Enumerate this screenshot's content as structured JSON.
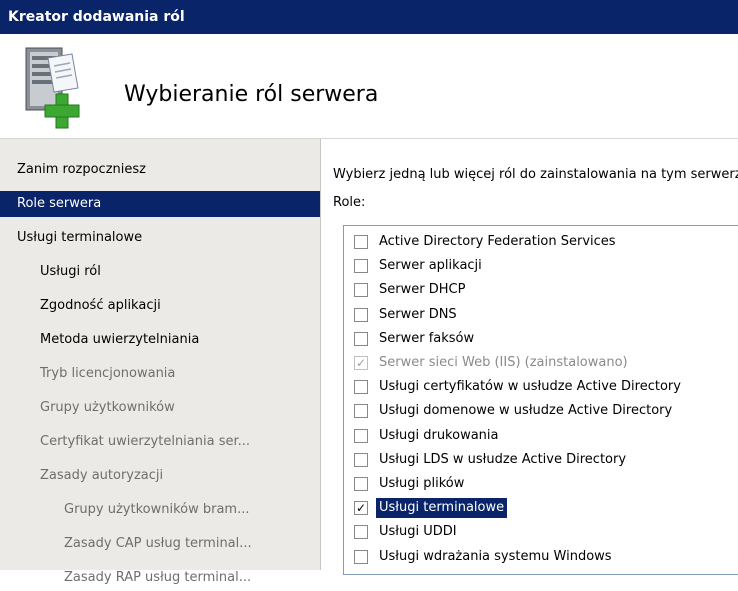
{
  "window": {
    "title": "Kreator dodawania ról"
  },
  "header": {
    "title": "Wybieranie ról serwera",
    "icon": "server-add-icon"
  },
  "nav": {
    "items": [
      {
        "label": "Zanim rozpoczniesz",
        "state": "normal",
        "indent": 0
      },
      {
        "label": "Role serwera",
        "state": "selected",
        "indent": 0
      },
      {
        "label": "Usługi terminalowe",
        "state": "normal",
        "indent": 0
      },
      {
        "label": "Usługi ról",
        "state": "active",
        "indent": 1
      },
      {
        "label": "Zgodność aplikacji",
        "state": "active",
        "indent": 1
      },
      {
        "label": "Metoda uwierzytelniania",
        "state": "active",
        "indent": 1
      },
      {
        "label": "Tryb licencjonowania",
        "state": "dim",
        "indent": 1
      },
      {
        "label": "Grupy użytkowników",
        "state": "dim",
        "indent": 1
      },
      {
        "label": "Certyfikat uwierzytelniania ser...",
        "state": "dim",
        "indent": 1
      },
      {
        "label": "Zasady autoryzacji",
        "state": "dim",
        "indent": 1
      },
      {
        "label": "Grupy użytkowników bram...",
        "state": "dim",
        "indent": 2
      },
      {
        "label": "Zasady CAP usług terminal...",
        "state": "dim",
        "indent": 2
      },
      {
        "label": "Zasady RAP usług terminal...",
        "state": "dim",
        "indent": 2
      }
    ]
  },
  "main": {
    "instruction": "Wybierz jedną lub więcej ról do zainstalowania na tym serwerze.",
    "roles_label": "Role:",
    "roles": [
      {
        "label": "Active Directory Federation Services",
        "checked": false,
        "disabled": false,
        "selected": false
      },
      {
        "label": "Serwer aplikacji",
        "checked": false,
        "disabled": false,
        "selected": false
      },
      {
        "label": "Serwer DHCP",
        "checked": false,
        "disabled": false,
        "selected": false
      },
      {
        "label": "Serwer DNS",
        "checked": false,
        "disabled": false,
        "selected": false
      },
      {
        "label": "Serwer faksów",
        "checked": false,
        "disabled": false,
        "selected": false
      },
      {
        "label": "Serwer sieci Web (IIS) (zainstalowano)",
        "checked": true,
        "disabled": true,
        "selected": false
      },
      {
        "label": "Usługi certyfikatów w usłudze Active Directory",
        "checked": false,
        "disabled": false,
        "selected": false
      },
      {
        "label": "Usługi domenowe w usłudze Active Directory",
        "checked": false,
        "disabled": false,
        "selected": false
      },
      {
        "label": "Usługi drukowania",
        "checked": false,
        "disabled": false,
        "selected": false
      },
      {
        "label": "Usługi LDS w usłudze Active Directory",
        "checked": false,
        "disabled": false,
        "selected": false
      },
      {
        "label": "Usługi plików",
        "checked": false,
        "disabled": false,
        "selected": false
      },
      {
        "label": "Usługi terminalowe",
        "checked": true,
        "disabled": false,
        "selected": true
      },
      {
        "label": "Usługi UDDI",
        "checked": false,
        "disabled": false,
        "selected": false
      },
      {
        "label": "Usługi wdrażania systemu Windows",
        "checked": false,
        "disabled": false,
        "selected": false
      }
    ]
  },
  "colors": {
    "titlebar": "#0a246a",
    "selection": "#0a246a",
    "pane": "#eceae6"
  }
}
